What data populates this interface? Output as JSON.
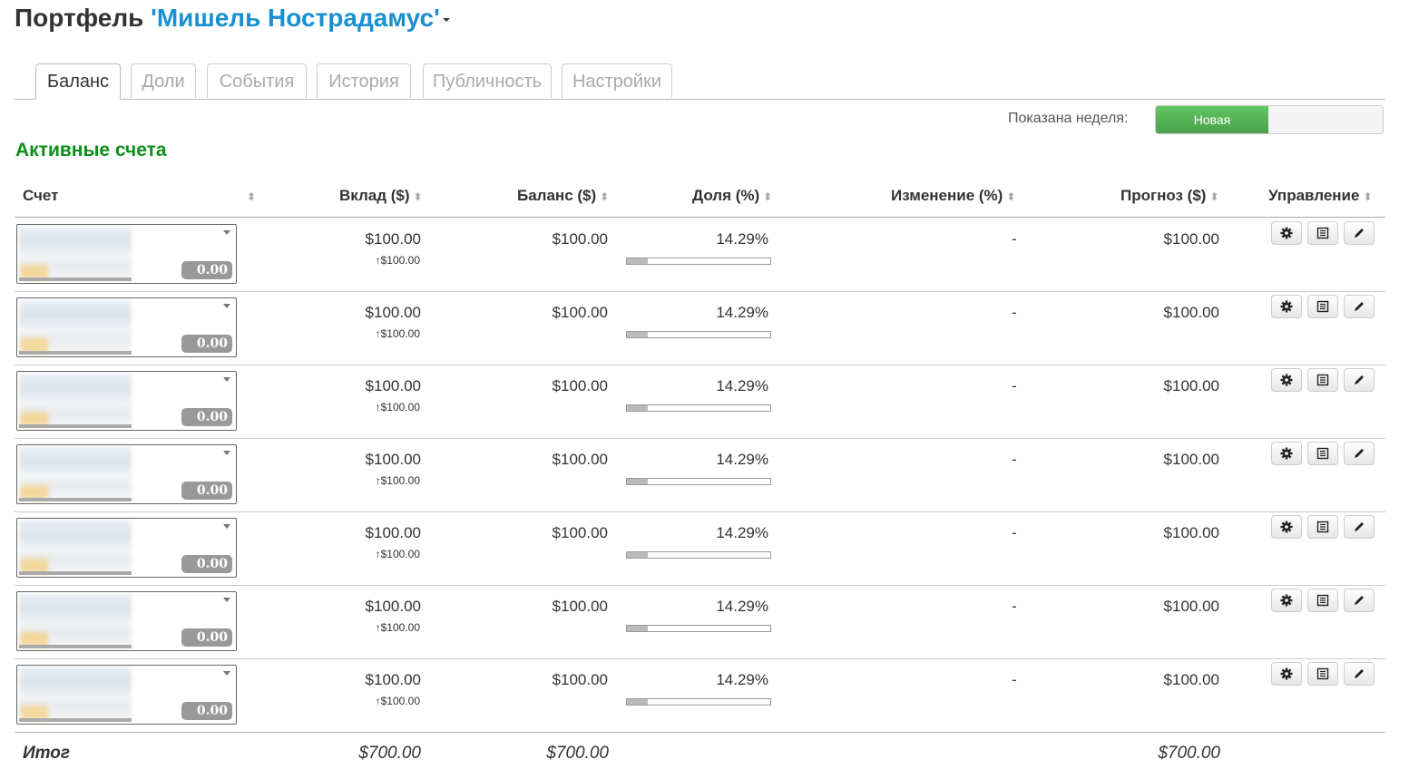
{
  "header": {
    "title_prefix": "Портфель",
    "portfolio_name": "'Мишель Нострадамус'"
  },
  "tabs": [
    {
      "label": "Баланс",
      "active": true
    },
    {
      "label": "Доли",
      "active": false
    },
    {
      "label": "События",
      "active": false
    },
    {
      "label": "История",
      "active": false
    },
    {
      "label": "Публичность",
      "active": false
    },
    {
      "label": "Настройки",
      "active": false
    }
  ],
  "week": {
    "label": "Показана неделя:",
    "toggle_on": "Новая"
  },
  "section": {
    "title": "Активные счета"
  },
  "table": {
    "columns": {
      "account": "Счет",
      "deposit": "Вклад ($)",
      "balance": "Баланс ($)",
      "share": "Доля (%)",
      "change": "Изменение (%)",
      "forecast": "Прогноз ($)",
      "manage": "Управление"
    },
    "sort_glyph": "⬍",
    "rows": [
      {
        "badge": "0.00",
        "deposit": "$100.00",
        "deposit_sub": "↑$100.00",
        "balance": "$100.00",
        "share": "14.29%",
        "share_fraction": 0.1429,
        "change": "-",
        "forecast": "$100.00"
      },
      {
        "badge": "0.00",
        "deposit": "$100.00",
        "deposit_sub": "↑$100.00",
        "balance": "$100.00",
        "share": "14.29%",
        "share_fraction": 0.1429,
        "change": "-",
        "forecast": "$100.00"
      },
      {
        "badge": "0.00",
        "deposit": "$100.00",
        "deposit_sub": "↑$100.00",
        "balance": "$100.00",
        "share": "14.29%",
        "share_fraction": 0.1429,
        "change": "-",
        "forecast": "$100.00"
      },
      {
        "badge": "0.00",
        "deposit": "$100.00",
        "deposit_sub": "↑$100.00",
        "balance": "$100.00",
        "share": "14.29%",
        "share_fraction": 0.1429,
        "change": "-",
        "forecast": "$100.00"
      },
      {
        "badge": "0.00",
        "deposit": "$100.00",
        "deposit_sub": "↑$100.00",
        "balance": "$100.00",
        "share": "14.29%",
        "share_fraction": 0.1429,
        "change": "-",
        "forecast": "$100.00"
      },
      {
        "badge": "0.00",
        "deposit": "$100.00",
        "deposit_sub": "↑$100.00",
        "balance": "$100.00",
        "share": "14.29%",
        "share_fraction": 0.1429,
        "change": "-",
        "forecast": "$100.00"
      },
      {
        "badge": "0.00",
        "deposit": "$100.00",
        "deposit_sub": "↑$100.00",
        "balance": "$100.00",
        "share": "14.29%",
        "share_fraction": 0.1429,
        "change": "-",
        "forecast": "$100.00"
      }
    ],
    "row_icons": [
      "gear-icon",
      "list-icon",
      "pencil-icon"
    ],
    "total": {
      "label": "Итог",
      "deposit": "$700.00",
      "balance": "$700.00",
      "forecast": "$700.00"
    }
  },
  "colors": {
    "portfolio_name": "#1a8fd1",
    "section_title": "#0a8f1a",
    "toggle_on": "#5cb85c",
    "badge": "#999999"
  }
}
